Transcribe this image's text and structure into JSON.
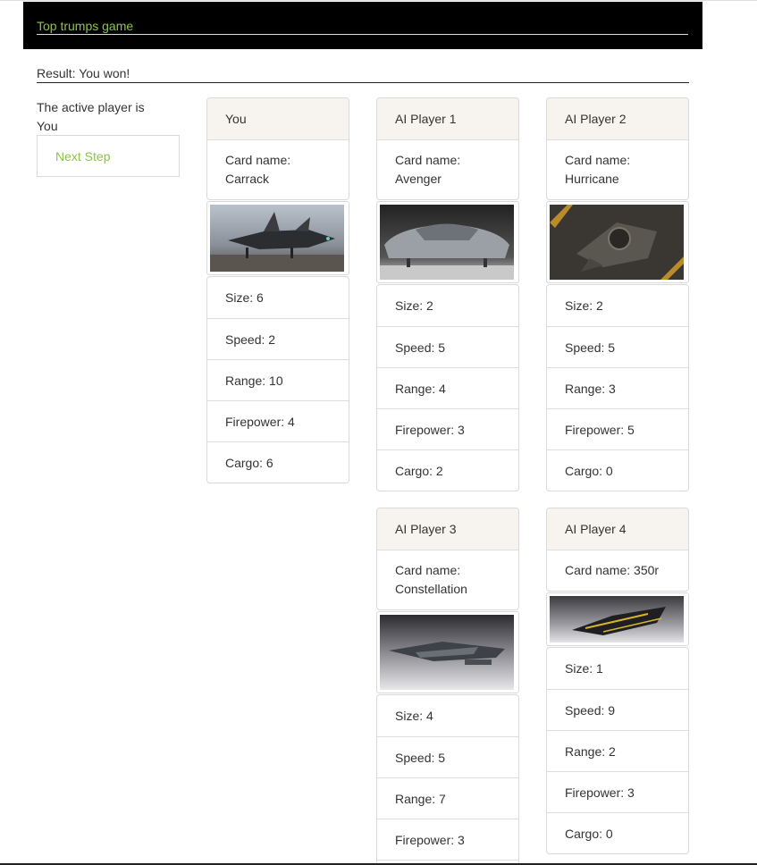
{
  "header": {
    "title": "Top trumps game"
  },
  "result": "Result: You won!",
  "active_player": "The active player is You",
  "next_step_label": "Next Step",
  "colors": {
    "accent": "#8bc34a",
    "header_bg": "#000000",
    "card_header_bg": "#f7f4ef"
  },
  "cards": [
    {
      "player": "You",
      "card_name": "Card name: Carrack",
      "size": "Size: 6",
      "speed": "Speed: 2",
      "range": "Range: 10",
      "firepower": "Firepower: 4",
      "cargo": "Cargo: 6"
    },
    {
      "player": "AI Player 1",
      "card_name": "Card name: Avenger",
      "size": "Size: 2",
      "speed": "Speed: 5",
      "range": "Range: 4",
      "firepower": "Firepower: 3",
      "cargo": "Cargo: 2"
    },
    {
      "player": "AI Player 2",
      "card_name": "Card name: Hurricane",
      "size": "Size: 2",
      "speed": "Speed: 5",
      "range": "Range: 3",
      "firepower": "Firepower: 5",
      "cargo": "Cargo: 0"
    },
    {
      "player": "AI Player 3",
      "card_name": "Card name: Constellation",
      "size": "Size: 4",
      "speed": "Speed: 5",
      "range": "Range: 7",
      "firepower": "Firepower: 3"
    },
    {
      "player": "AI Player 4",
      "card_name": "Card name: 350r",
      "size": "Size: 1",
      "speed": "Speed: 9",
      "range": "Range: 2",
      "firepower": "Firepower: 3",
      "cargo": "Cargo: 0"
    }
  ]
}
